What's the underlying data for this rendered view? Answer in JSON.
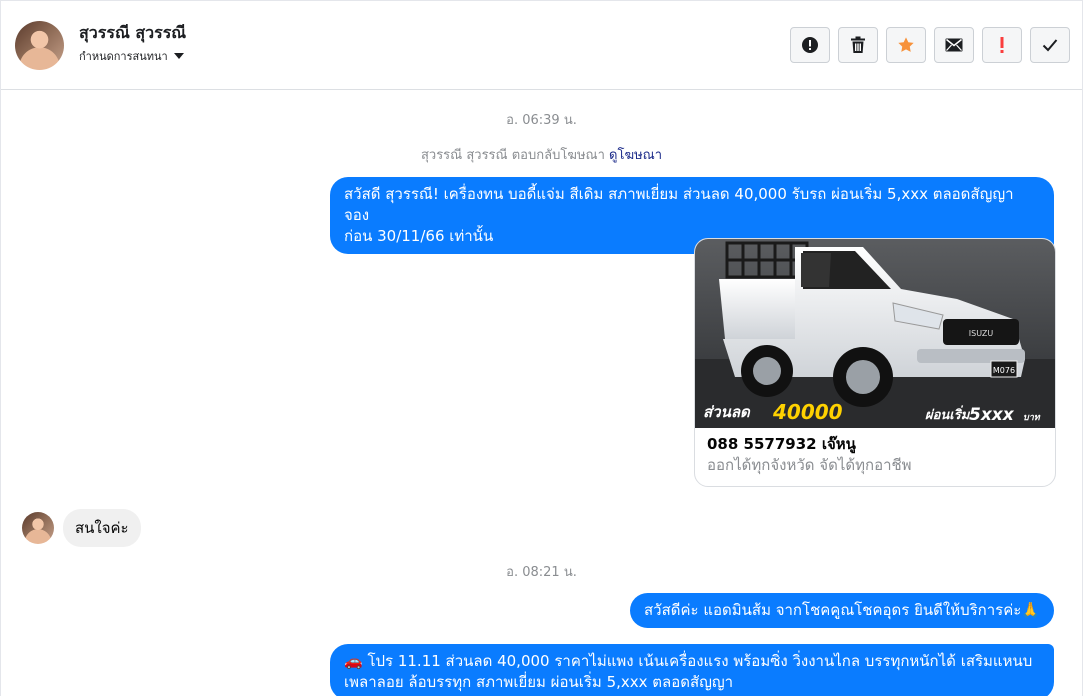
{
  "header": {
    "contact_name": "สุวรรณี สุวรรณี",
    "conversation_setting": "กำหนดการสนทนา"
  },
  "toolbar": {
    "buttons": [
      {
        "name": "report-button",
        "icon": "alert-circle-icon"
      },
      {
        "name": "delete-button",
        "icon": "trash-icon"
      },
      {
        "name": "star-button",
        "icon": "star-icon",
        "color": "#f7923b"
      },
      {
        "name": "mark-unread-button",
        "icon": "envelope-icon"
      },
      {
        "name": "important-button",
        "icon": "exclamation-icon",
        "color": "#fa3e3e"
      },
      {
        "name": "done-button",
        "icon": "check-icon"
      }
    ]
  },
  "messages": {
    "timestamp_1": "อ. 06:39 น.",
    "ad_reply_text": "สุวรรณี สุวรรณี ตอบกลับโฆษณา",
    "ad_reply_link": "ดูโฆษณา",
    "out_1_line1": "สวัสดี สุวรรณี! เครื่องทน บอดี้แจ่ม สีเดิม สภาพเยี่ยม ส่วนลด 40,000 รับรถ ผ่อนเริ่ม 5,xxx ตลอดสัญญา จอง",
    "out_1_line2": "ก่อน 30/11/66 เท่านั้น",
    "ad_card": {
      "image_text_left": "ส่วนลด",
      "image_text_amount": "40000",
      "image_text_right": "ผ่อนเริ่ม",
      "image_text_price": "5xxx",
      "image_text_unit": "บาท",
      "plate": "M076",
      "brand": "ISUZU",
      "title": "088 5577932 เจ๊หนู",
      "subtitle": "ออกได้ทุกจังหวัด จัดได้ทุกอาชีพ"
    },
    "in_1": "สนใจค่ะ",
    "timestamp_2": "อ. 08:21 น.",
    "out_2": "สวัสดีค่ะ แอดมินส้ม จากโชคคูณโชคอุดร ยินดีให้บริการค่ะ🙏",
    "out_3_line1": "🚗 โปร 11.11 ส่วนลด 40,000 ราคาไม่แพง เน้นเครื่องแรง พร้อมซิ่ง วิ่งงานไกล บรรทุกหนักได้ เสริมแหนบ",
    "out_3_line2": "เพลาลอย ล้อบรรทุก สภาพเยี่ยม ผ่อนเริ่ม 5,xxx ตลอดสัญญา"
  }
}
